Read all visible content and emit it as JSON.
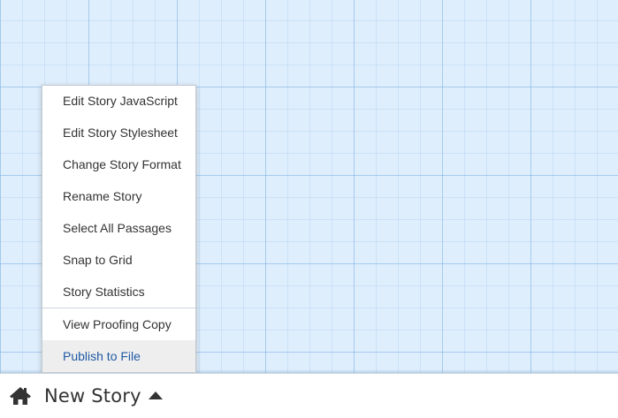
{
  "story": {
    "title": "New Story"
  },
  "toolbar": {
    "home_icon": "home-icon",
    "caret_icon": "caret-up-icon"
  },
  "menu": {
    "group1": [
      {
        "label": "Edit Story JavaScript"
      },
      {
        "label": "Edit Story Stylesheet"
      },
      {
        "label": "Change Story Format"
      },
      {
        "label": "Rename Story"
      },
      {
        "label": "Select All Passages"
      },
      {
        "label": "Snap to Grid"
      },
      {
        "label": "Story Statistics"
      }
    ],
    "group2": [
      {
        "label": "View Proofing Copy"
      },
      {
        "label": "Publish to File",
        "highlighted": true
      }
    ]
  },
  "colors": {
    "canvas_background": "#dfeefc",
    "grid_line": "#78afe1",
    "highlight_background": "#eeeeee",
    "highlight_text": "#1f5aa6",
    "text": "#333333"
  }
}
